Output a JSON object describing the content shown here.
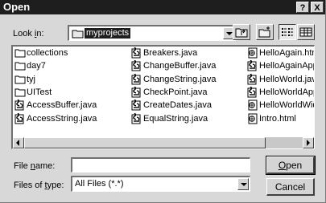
{
  "window": {
    "title": "Open",
    "help_label": "?",
    "close_label": "X"
  },
  "look_in": {
    "label_prefix": "Look ",
    "label_underlined": "i",
    "label_suffix": "n:",
    "value": "myprojects"
  },
  "toolbar": {
    "buttons": [
      "up-one-level",
      "create-new-folder",
      "list-view",
      "details-view"
    ],
    "active": "list-view"
  },
  "files": {
    "column1": [
      {
        "name": "collections",
        "type": "folder"
      },
      {
        "name": "day7",
        "type": "folder"
      },
      {
        "name": "tyj",
        "type": "folder"
      },
      {
        "name": "UITest",
        "type": "folder"
      },
      {
        "name": "AccessBuffer.java",
        "type": "java"
      },
      {
        "name": "AccessString.java",
        "type": "java"
      }
    ],
    "column2": [
      {
        "name": "Breakers.java",
        "type": "java"
      },
      {
        "name": "ChangeBuffer.java",
        "type": "java"
      },
      {
        "name": "ChangeString.java",
        "type": "java"
      },
      {
        "name": "CheckPoint.java",
        "type": "java"
      },
      {
        "name": "CreateDates.java",
        "type": "java"
      },
      {
        "name": "EqualString.java",
        "type": "java"
      }
    ],
    "column3": [
      {
        "name": "HelloAgain.html",
        "type": "html"
      },
      {
        "name": "HelloAgainApplet.",
        "type": "java"
      },
      {
        "name": "HelloWorld.java",
        "type": "java"
      },
      {
        "name": "HelloWorldApplet.",
        "type": "java"
      },
      {
        "name": "HelloWorldWideW",
        "type": "html"
      },
      {
        "name": "Intro.html",
        "type": "html"
      }
    ]
  },
  "file_name": {
    "label_prefix": "File ",
    "label_underlined": "n",
    "label_suffix": "ame:",
    "value": ""
  },
  "file_type": {
    "label_prefix": "Files of ",
    "label_underlined": "t",
    "label_suffix": "ype:",
    "value": "All Files (*.*)"
  },
  "buttons": {
    "open": {
      "underlined": "O",
      "rest": "pen"
    },
    "cancel": {
      "label": "Cancel"
    }
  }
}
